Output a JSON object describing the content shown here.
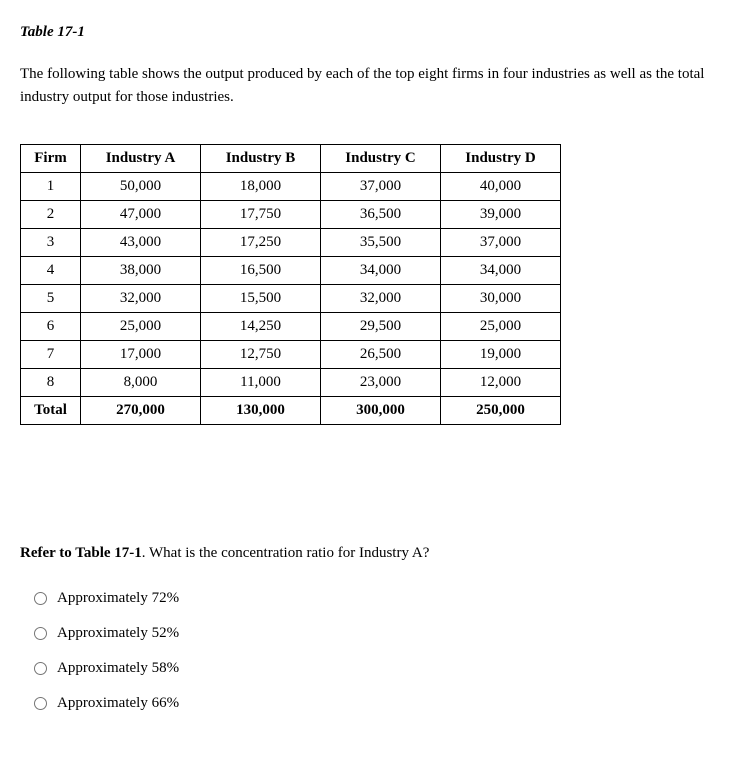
{
  "title": "Table 17-1",
  "description": "The following table shows the output produced by each of the top eight firms in four industries as well as the total industry output for those industries.",
  "table": {
    "headers": [
      "Firm",
      "Industry A",
      "Industry B",
      "Industry C",
      "Industry D"
    ],
    "rows": [
      [
        "1",
        "50,000",
        "18,000",
        "37,000",
        "40,000"
      ],
      [
        "2",
        "47,000",
        "17,750",
        "36,500",
        "39,000"
      ],
      [
        "3",
        "43,000",
        "17,250",
        "35,500",
        "37,000"
      ],
      [
        "4",
        "38,000",
        "16,500",
        "34,000",
        "34,000"
      ],
      [
        "5",
        "32,000",
        "15,500",
        "32,000",
        "30,000"
      ],
      [
        "6",
        "25,000",
        "14,250",
        "29,500",
        "25,000"
      ],
      [
        "7",
        "17,000",
        "12,750",
        "26,500",
        "19,000"
      ],
      [
        "8",
        "8,000",
        "11,000",
        "23,000",
        "12,000"
      ]
    ],
    "totalRow": [
      "Total",
      "270,000",
      "130,000",
      "300,000",
      "250,000"
    ]
  },
  "question": {
    "prefix": "Refer to Table 17-1",
    "text": ". What is the concentration ratio for Industry A?"
  },
  "options": [
    "Approximately 72%",
    "Approximately 52%",
    "Approximately 58%",
    "Approximately 66%"
  ],
  "chart_data": {
    "type": "table",
    "title": "Table 17-1",
    "description": "Output produced by top eight firms in four industries and total industry output",
    "columns": [
      "Firm",
      "Industry A",
      "Industry B",
      "Industry C",
      "Industry D"
    ],
    "data": [
      {
        "Firm": 1,
        "Industry A": 50000,
        "Industry B": 18000,
        "Industry C": 37000,
        "Industry D": 40000
      },
      {
        "Firm": 2,
        "Industry A": 47000,
        "Industry B": 17750,
        "Industry C": 36500,
        "Industry D": 39000
      },
      {
        "Firm": 3,
        "Industry A": 43000,
        "Industry B": 17250,
        "Industry C": 35500,
        "Industry D": 37000
      },
      {
        "Firm": 4,
        "Industry A": 38000,
        "Industry B": 16500,
        "Industry C": 34000,
        "Industry D": 34000
      },
      {
        "Firm": 5,
        "Industry A": 32000,
        "Industry B": 15500,
        "Industry C": 32000,
        "Industry D": 30000
      },
      {
        "Firm": 6,
        "Industry A": 25000,
        "Industry B": 14250,
        "Industry C": 29500,
        "Industry D": 25000
      },
      {
        "Firm": 7,
        "Industry A": 17000,
        "Industry B": 12750,
        "Industry C": 26500,
        "Industry D": 19000
      },
      {
        "Firm": 8,
        "Industry A": 8000,
        "Industry B": 11000,
        "Industry C": 23000,
        "Industry D": 12000
      }
    ],
    "totals": {
      "Industry A": 270000,
      "Industry B": 130000,
      "Industry C": 300000,
      "Industry D": 250000
    }
  }
}
